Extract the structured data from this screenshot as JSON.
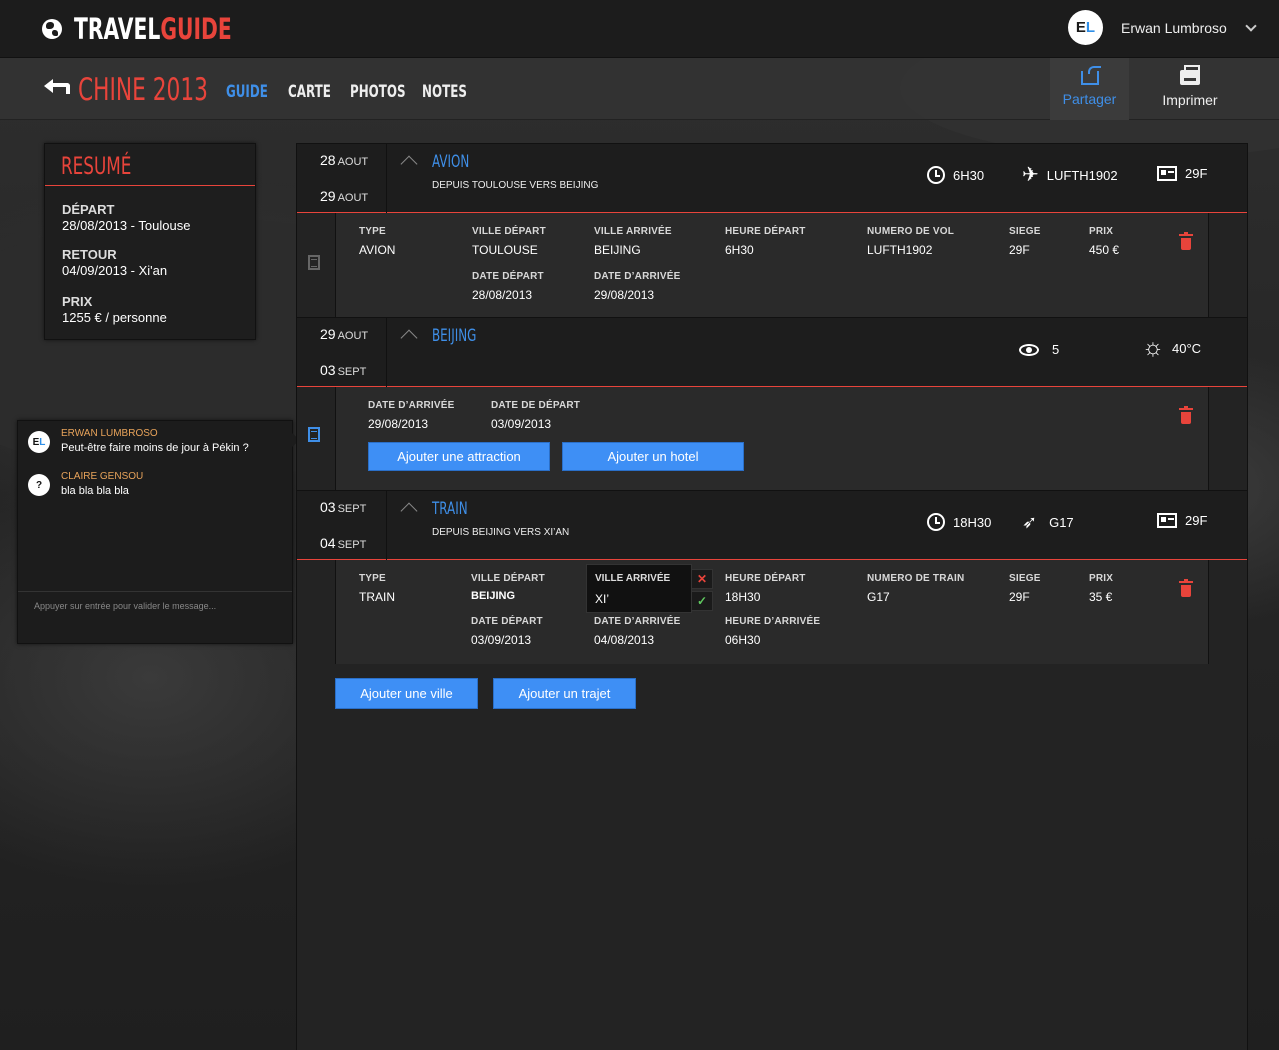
{
  "app": {
    "brand_part1": "TRAVEL",
    "brand_part2": "GUIDE"
  },
  "user": {
    "initials_e": "E",
    "initials_l": "L",
    "name": "Erwan Lumbroso"
  },
  "trip": {
    "title": "CHINE 2013"
  },
  "nav": {
    "tabs": [
      {
        "label": "GUIDE",
        "active": true
      },
      {
        "label": "CARTE"
      },
      {
        "label": "PHOTOS"
      },
      {
        "label": "NOTES"
      }
    ]
  },
  "actions": {
    "share": "Partager",
    "print": "Imprimer"
  },
  "resume": {
    "title": "RESUMÉ",
    "depart_label": "DÉPART",
    "depart_value": "28/08/2013  - Toulouse",
    "retour_label": "RETOUR",
    "retour_value": "04/09/2013  - Xi'an",
    "prix_label": "PRIX",
    "prix_value": "1255 € / personne"
  },
  "chat": {
    "messages": [
      {
        "author": "ERWAN LUMBROSO",
        "text": "Peut-être faire moins  de jour à Pékin ?",
        "avatar": "EL"
      },
      {
        "author": "CLAIRE GENSOU",
        "text": "bla bla bla bla",
        "avatar": "?"
      }
    ],
    "input_placeholder": "Appuyer sur entrée pour valider le message..."
  },
  "steps": [
    {
      "start_day": "28",
      "start_month": "AOUT",
      "end_day": "29",
      "end_month": "AOUT",
      "title": "AVION",
      "subtitle": "DEPUIS TOULOUSE VERS BEIJING",
      "stat_time": "6H30",
      "stat_flight": "LUFTH1902",
      "stat_seat": "29F",
      "fields": {
        "type_l": "TYPE",
        "type_v": "AVION",
        "vd_l": "VILLE DÉPART",
        "vd_v": "TOULOUSE",
        "va_l": "VILLE ARRIVÉE",
        "va_v": "BEIJING",
        "hd_l": "HEURE DÉPART",
        "hd_v": "6H30",
        "nv_l": "NUMERO DE VOL",
        "nv_v": "LUFTH1902",
        "siege_l": "SIEGE",
        "siege_v": "29F",
        "prix_l": "PRIX",
        "prix_v": "450 €",
        "dd_l": "DATE DÉPART",
        "dd_v": "28/08/2013",
        "da_l": "DATE D’ARRIVÉE",
        "da_v": "29/08/2013"
      }
    },
    {
      "start_day": "29",
      "start_month": "AOUT",
      "end_day": "03",
      "end_month": "SEPT",
      "title": "BEIJING",
      "stat_views": "5",
      "stat_temp": "40°C",
      "fields": {
        "da_l": "DATE D’ARRIVÉE",
        "da_v": "29/08/2013",
        "dd_l": "DATE DE DÉPART",
        "dd_v": "03/09/2013"
      },
      "btn_attraction": "Ajouter une attraction",
      "btn_hotel": "Ajouter un hotel"
    },
    {
      "start_day": "03",
      "start_month": "SEPT",
      "end_day": "04",
      "end_month": "SEPT",
      "title": "TRAIN",
      "subtitle": "DEPUIS BEIJING VERS XI’AN",
      "stat_time": "18H30",
      "stat_train": "G17",
      "stat_seat": "29F",
      "fields": {
        "type_l": "TYPE",
        "type_v": "TRAIN",
        "vd_l": "VILLE DÉPART",
        "vd_v": "BEIJING",
        "va_l": "VILLE ARRIVÉE",
        "va_v": "XI’",
        "hd_l": "HEURE DÉPART",
        "hd_v": "18H30",
        "nt_l": "NUMERO DE TRAIN",
        "nt_v": "G17",
        "siege_l": "SIEGE",
        "siege_v": "29F",
        "prix_l": "PRIX",
        "prix_v": "35 €",
        "dd_l": "DATE DÉPART",
        "dd_v": "03/09/2013",
        "da_l": "DATE D’ARRIVÉE",
        "da_v": "04/08/2013",
        "ha_l": "HEURE D’ARRIVÉE",
        "ha_v": "06H30"
      }
    }
  ],
  "bottom": {
    "add_city": "Ajouter une ville",
    "add_trip": "Ajouter un trajet"
  },
  "colors": {
    "accent_blue": "#3f8fe8",
    "accent_red": "#e8443b",
    "bg": "#1b1b1b"
  }
}
